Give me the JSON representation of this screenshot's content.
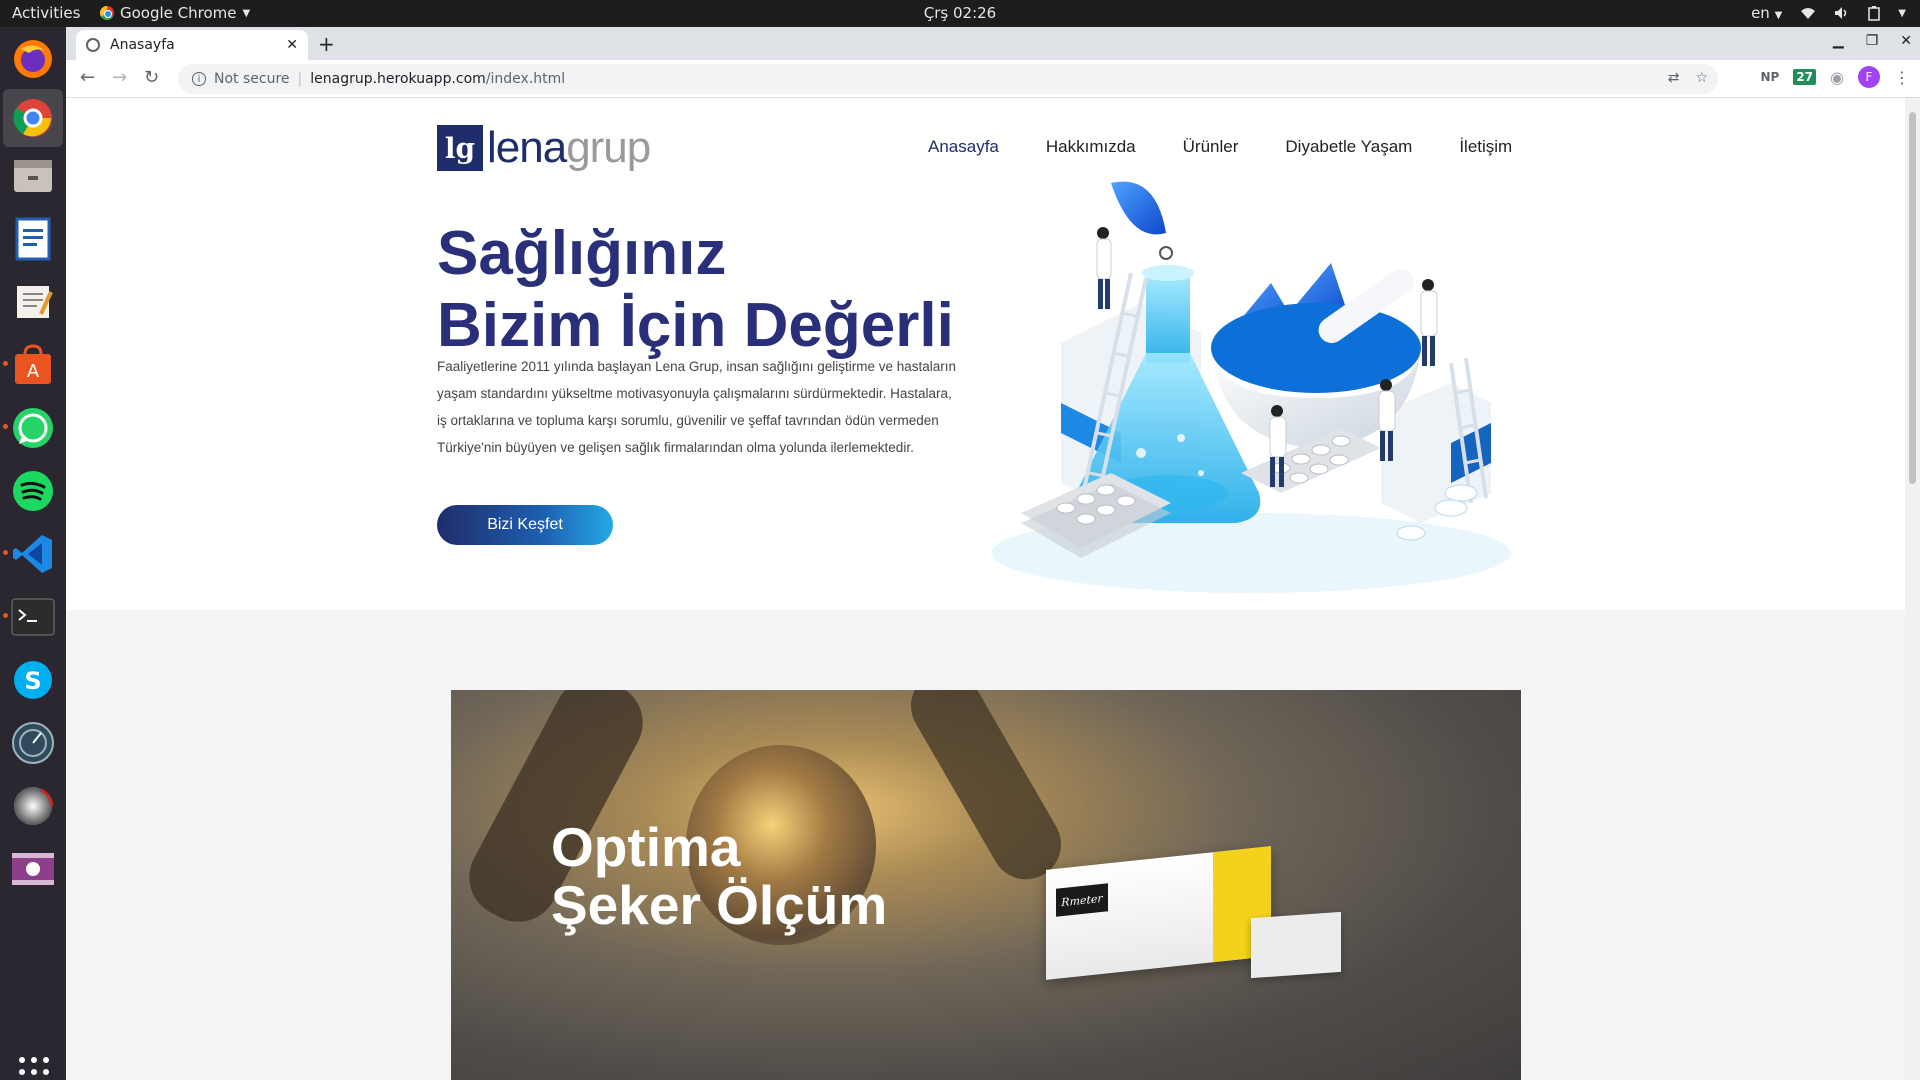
{
  "system": {
    "activities": "Activities",
    "app_name": "Google Chrome",
    "clock": "Çrş 02:26",
    "language": "en"
  },
  "browser": {
    "tab_title": "Anasayfa",
    "security": "Not secure",
    "url_host": "lenagrup.herokuapp.com",
    "url_path": "/index.html",
    "extensions": [
      "NP",
      "27"
    ],
    "profile_initial": "F"
  },
  "site": {
    "logo": {
      "mark": "lg",
      "lena": "lena",
      "grup": "grup"
    },
    "nav": [
      "Anasayfa",
      "Hakkımızda",
      "Ürünler",
      "Diyabetle Yaşam",
      "İletişim"
    ],
    "hero": {
      "title_line1": "Sağlığınız",
      "title_line2": "Bizim İçin Değerli",
      "description": "Faaliyetlerine 2011 yılında başlayan Lena Grup, insan sağlığını geliştirme ve hastaların yaşam standardını yükseltme motivasyonuyla çalışmalarını sürdürmektedir. Hastalara, iş ortaklarına ve topluma karşı sorumlu, güvenilir ve şeffaf tavrından ödün vermeden Türkiye'nin büyüyen ve gelişen sağlık firmalarından olma yolunda ilerlemektedir.",
      "cta": "Bizi Keşfet"
    },
    "banner": {
      "title_line1": "Optima",
      "title_line2": "Şeker Ölçüm",
      "product_brand": "Rmeter"
    }
  },
  "colors": {
    "brand_navy": "#1f2d6b",
    "hero_title": "#2a2f7a",
    "cta_start": "#1f2d6b",
    "cta_end": "#25a9e6"
  },
  "dock_apps": [
    "firefox-icon",
    "chrome-icon",
    "files-icon",
    "writer-icon",
    "text-editor-icon",
    "software-center-icon",
    "whatsapp-icon",
    "spotify-icon",
    "vscode-icon",
    "terminal-icon",
    "skype-icon",
    "disk-usage-icon",
    "disk-icon",
    "video-icon"
  ]
}
